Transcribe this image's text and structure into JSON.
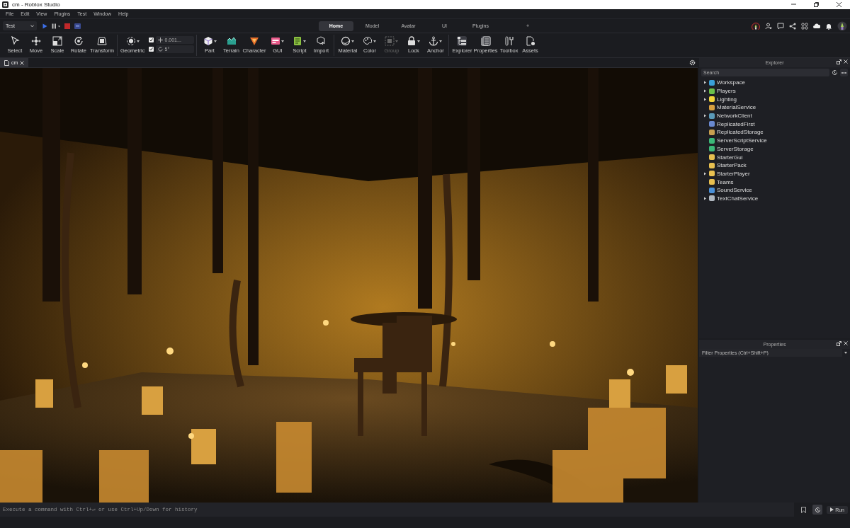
{
  "window": {
    "title": "cm - Roblox Studio"
  },
  "menu": [
    "File",
    "Edit",
    "View",
    "Plugins",
    "Test",
    "Window",
    "Help"
  ],
  "mode_select": {
    "value": "Test"
  },
  "ribbon_tabs": [
    {
      "label": "Home",
      "selected": true
    },
    {
      "label": "Model",
      "selected": false
    },
    {
      "label": "Avatar",
      "selected": false
    },
    {
      "label": "UI",
      "selected": false
    },
    {
      "label": "Plugins",
      "selected": false
    },
    {
      "label": "+",
      "selected": false
    }
  ],
  "ribbon_groups": [
    {
      "kind": "tools",
      "tools": [
        {
          "label": "Select",
          "dropdown": false,
          "disabled": false,
          "selected": false
        },
        {
          "label": "Move",
          "dropdown": false,
          "disabled": false,
          "selected": false
        },
        {
          "label": "Scale",
          "dropdown": false,
          "disabled": false,
          "selected": false
        },
        {
          "label": "Rotate",
          "dropdown": false,
          "disabled": false,
          "selected": false
        },
        {
          "label": "Transform",
          "dropdown": false,
          "disabled": false,
          "selected": false
        }
      ]
    },
    {
      "kind": "snap",
      "tools": [
        {
          "label": "Geometric",
          "dropdown": true,
          "disabled": false,
          "selected": false
        }
      ],
      "snaps": [
        {
          "value": "0.001...",
          "checked": true
        },
        {
          "value": "5°",
          "checked": true
        }
      ]
    },
    {
      "kind": "tools",
      "tools": [
        {
          "label": "Part",
          "dropdown": true,
          "disabled": false,
          "selected": false
        },
        {
          "label": "Terrain",
          "dropdown": false,
          "disabled": false,
          "selected": false
        },
        {
          "label": "Character",
          "dropdown": false,
          "disabled": false,
          "selected": false
        },
        {
          "label": "GUI",
          "dropdown": true,
          "disabled": false,
          "selected": false
        },
        {
          "label": "Script",
          "dropdown": true,
          "disabled": false,
          "selected": false
        },
        {
          "label": "Import",
          "dropdown": false,
          "disabled": false,
          "selected": false
        }
      ]
    },
    {
      "kind": "tools",
      "tools": [
        {
          "label": "Material",
          "dropdown": true,
          "disabled": false,
          "selected": false
        },
        {
          "label": "Color",
          "dropdown": true,
          "disabled": false,
          "selected": false
        },
        {
          "label": "Group",
          "dropdown": true,
          "disabled": true,
          "selected": false
        },
        {
          "label": "Lock",
          "dropdown": true,
          "disabled": false,
          "selected": false
        },
        {
          "label": "Anchor",
          "dropdown": true,
          "disabled": false,
          "selected": false
        }
      ]
    },
    {
      "kind": "tools",
      "tools": [
        {
          "label": "Explorer",
          "dropdown": false,
          "disabled": false,
          "selected": true
        },
        {
          "label": "Properties",
          "dropdown": false,
          "disabled": false,
          "selected": true
        },
        {
          "label": "Toolbox",
          "dropdown": false,
          "disabled": false,
          "selected": false
        },
        {
          "label": "Assets",
          "dropdown": false,
          "disabled": false,
          "selected": false
        }
      ]
    }
  ],
  "document_tabs": [
    {
      "label": "cm",
      "selected": true
    }
  ],
  "explorer": {
    "title": "Explorer",
    "search": {
      "placeholder": "Search"
    },
    "items": [
      {
        "label": "Workspace",
        "expandable": true,
        "color": "#3aa0d8"
      },
      {
        "label": "Players",
        "expandable": true,
        "color": "#6cc04a"
      },
      {
        "label": "Lighting",
        "expandable": true,
        "color": "#f2d43a"
      },
      {
        "label": "MaterialService",
        "expandable": false,
        "color": "#d8a040"
      },
      {
        "label": "NetworkClient",
        "expandable": true,
        "color": "#5a9ab8"
      },
      {
        "label": "ReplicatedFirst",
        "expandable": false,
        "color": "#6a8ad0"
      },
      {
        "label": "ReplicatedStorage",
        "expandable": false,
        "color": "#c8a050"
      },
      {
        "label": "ServerScriptService",
        "expandable": false,
        "color": "#3cb878"
      },
      {
        "label": "ServerStorage",
        "expandable": false,
        "color": "#3cb878"
      },
      {
        "label": "StarterGui",
        "expandable": false,
        "color": "#e8c050"
      },
      {
        "label": "StarterPack",
        "expandable": false,
        "color": "#e8c050"
      },
      {
        "label": "StarterPlayer",
        "expandable": true,
        "color": "#e8c050"
      },
      {
        "label": "Teams",
        "expandable": false,
        "color": "#e8c050"
      },
      {
        "label": "SoundService",
        "expandable": false,
        "color": "#4a90d8"
      },
      {
        "label": "TextChatService",
        "expandable": true,
        "color": "#b0b8c0"
      }
    ]
  },
  "properties": {
    "title": "Properties",
    "filter": {
      "placeholder": "Filter Properties (Ctrl+Shift+P)"
    }
  },
  "command_bar": {
    "placeholder": "Execute a command with Ctrl+↵ or use Ctrl+Up/Down for history",
    "run_label": "Run"
  }
}
